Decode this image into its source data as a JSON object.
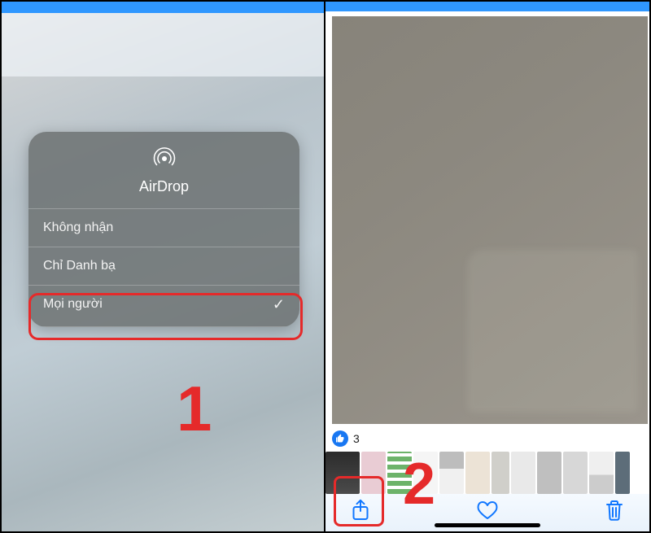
{
  "colors": {
    "accent_red": "#e52a2a",
    "ios_blue": "#2f97ff",
    "like_blue": "#1877f2"
  },
  "airdrop": {
    "title": "AirDrop",
    "options": {
      "off": "Không nhận",
      "contacts": "Chỉ Danh bạ",
      "everyone": "Mọi người"
    },
    "selected_checkmark": "✓"
  },
  "likes": {
    "count": "3"
  },
  "steps": {
    "one": "1",
    "two": "2"
  }
}
